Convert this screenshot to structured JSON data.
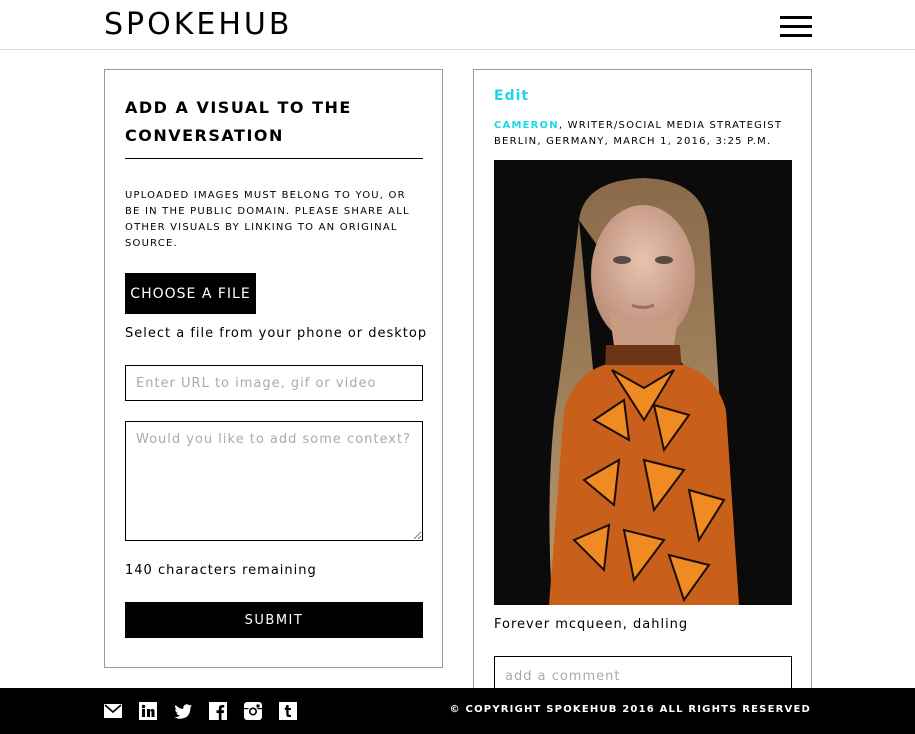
{
  "header": {
    "logo": "SPOKEHUB",
    "menu_icon": "hamburger-menu-icon"
  },
  "upload_panel": {
    "title": "ADD A VISUAL TO THE CONVERSATION",
    "notice": "UPLOADED IMAGES MUST BELONG TO YOU, OR BE IN THE PUBLIC DOMAIN. PLEASE SHARE ALL OTHER VISUALS BY LINKING TO AN ORIGINAL SOURCE.",
    "choose_file_label": "CHOOSE A FILE",
    "choose_file_hint": "Select a file from your phone or desktop",
    "url_placeholder": "Enter URL to image, gif or video",
    "context_placeholder": "Would you like to add some context?",
    "chars_remaining": "140 characters remaining",
    "submit_label": "SUBMIT"
  },
  "post_panel": {
    "edit_label": "Edit",
    "author": "CAMERON",
    "author_role": ", WRITER/SOCIAL MEDIA STRATEGIST",
    "location_time": "BERLIN, GERMANY, MARCH 1, 2016, 3:25 P.M.",
    "caption": "Forever mcqueen, dahling",
    "comment_placeholder": "add a comment",
    "accent_color": "#1ed6e8"
  },
  "footer": {
    "social_icons": [
      "email-icon",
      "linkedin-icon",
      "twitter-icon",
      "facebook-icon",
      "instagram-icon",
      "tumblr-icon"
    ],
    "copyright": "© COPYRIGHT SPOKEHUB 2016 ALL RIGHTS RESERVED"
  }
}
